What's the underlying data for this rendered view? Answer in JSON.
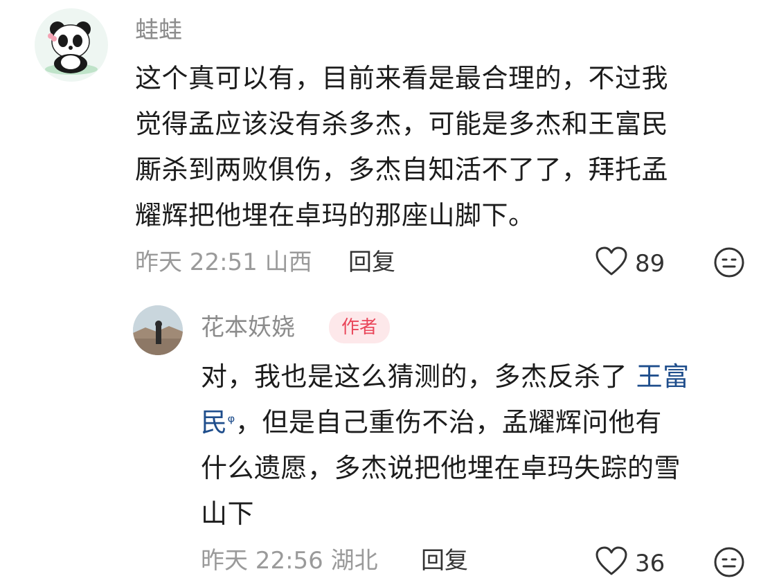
{
  "comments": [
    {
      "username": "蛙蛙",
      "text_lines": [
        "这个真可以有，目前来看是最合理的，不过我",
        "觉得孟应该没有杀多杰，可能是多杰和王富民",
        "厮杀到两败俱伤，多杰自知活不了了，拜托孟",
        "耀辉把他埋在卓玛的那座山脚下。"
      ],
      "time": "昨天 22:51",
      "location": "山西",
      "reply_label": "回复",
      "likes": "89"
    },
    {
      "username": "花本妖娆",
      "badge": "作者",
      "line1_text": "对，我也是这么猜测的，多杰反杀了",
      "link_part1": "王富",
      "link_part2": "民",
      "search_glyph": "ᵠ",
      "line2_rest": "，但是自己重伤不治，孟耀辉问他有",
      "line3": "什么遗愿，多杰说把他埋在卓玛失踪的雪",
      "line4": "山下",
      "time": "昨天 22:56",
      "location": "湖北",
      "reply_label": "回复",
      "likes": "36"
    }
  ],
  "colors": {
    "username": "#8c8c8c",
    "link": "#1f4e8c",
    "badge_bg": "#fde8ea",
    "badge_text": "#e9465a"
  },
  "icons": [
    "panda-avatar",
    "person-avatar",
    "heart-icon",
    "face-icon",
    "search-icon"
  ]
}
